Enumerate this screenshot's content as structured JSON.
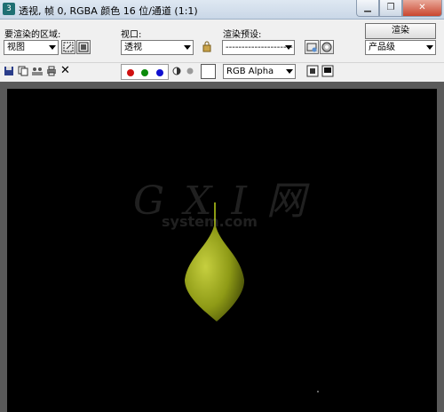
{
  "window": {
    "title": "透视, 帧 0, RGBA 颜色 16 位/通道 (1:1)",
    "icon": "3ds-max-icon",
    "buttons": [
      "minimize",
      "maximize",
      "close"
    ]
  },
  "toolbar": {
    "area_label": "要渲染的区域:",
    "area_value": "视图",
    "viewport_label": "视口:",
    "viewport_value": "透视",
    "preset_label": "渲染预设:",
    "preset_value": "-------------------------",
    "render_button": "渲染",
    "quality_value": "产品级",
    "channel_value": "RGB Alpha"
  },
  "channels": {
    "red": "#d01010",
    "green": "#0a8a0a",
    "blue": "#1010d0"
  },
  "watermark": {
    "big": "G X I 网",
    "small": "system.com"
  },
  "render": {
    "object_color": "#8e9a16",
    "background": "#000000"
  }
}
